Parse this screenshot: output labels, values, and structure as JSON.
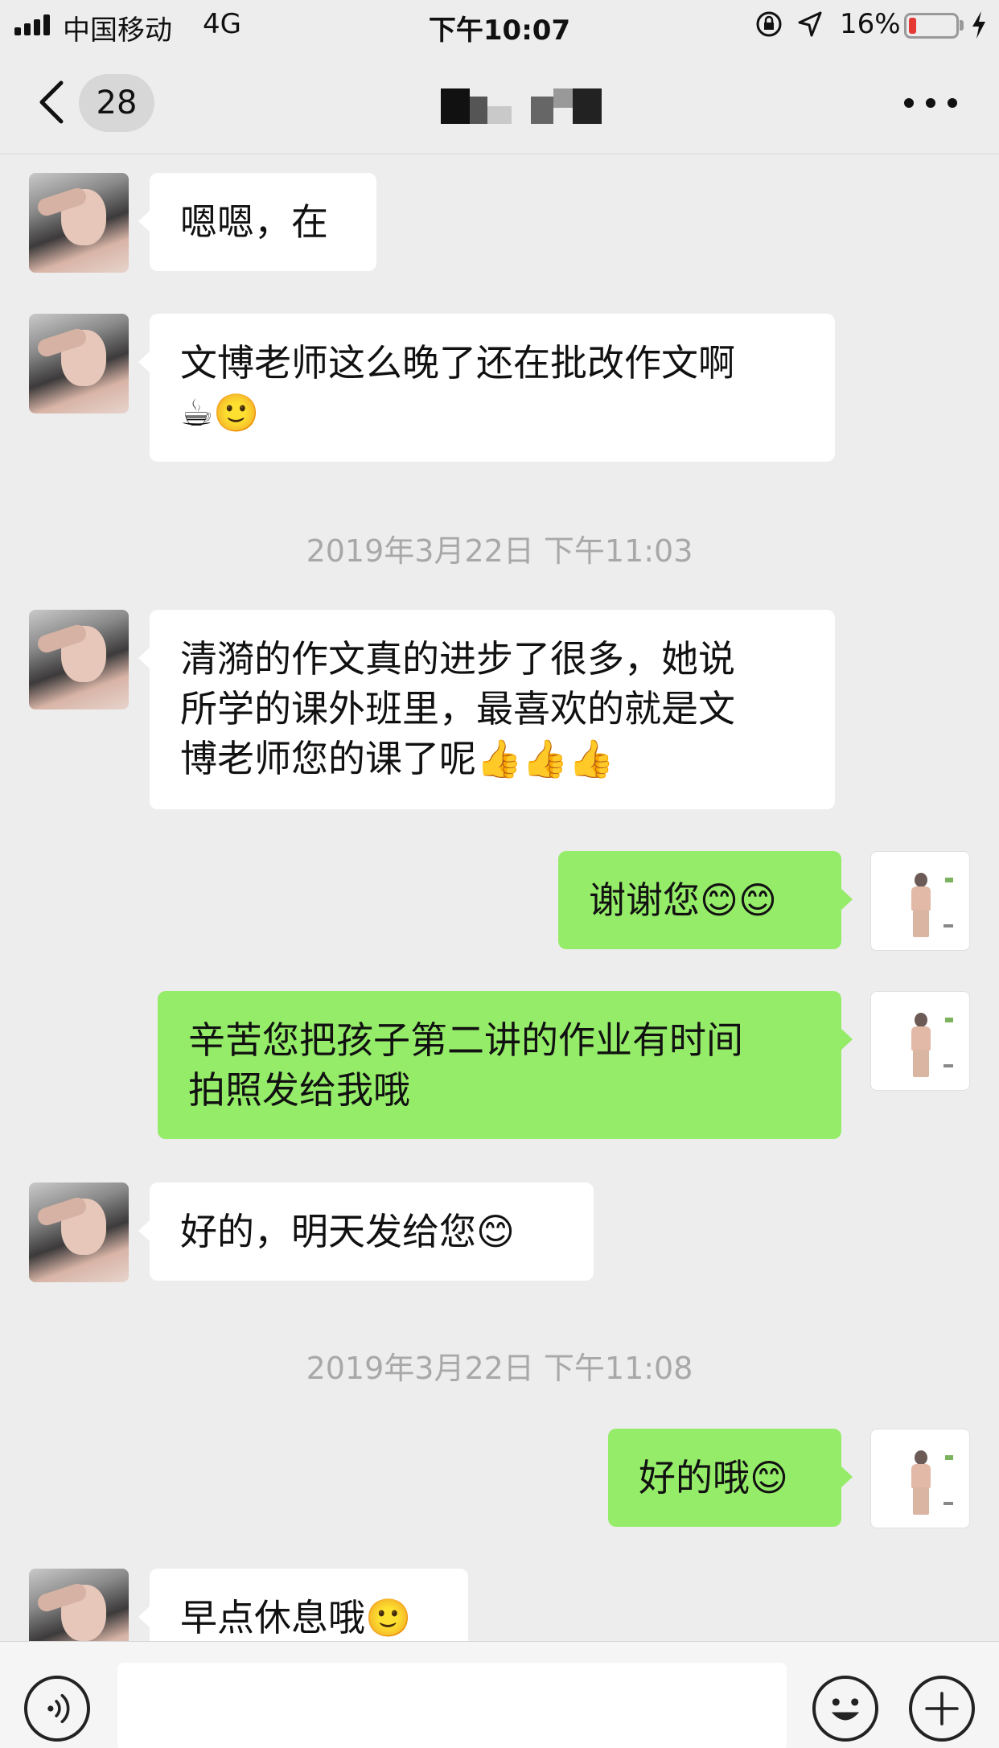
{
  "status_bar": {
    "carrier": "中国移动",
    "network": "4G",
    "time": "下午10:07",
    "battery_percent": "16%",
    "battery_level": 0.16,
    "battery_color": "#e53935"
  },
  "nav": {
    "unread_count": "28",
    "back_icon": "chevron-left-icon",
    "more_icon": "more-dots-icon"
  },
  "messages": [
    {
      "side": "in",
      "text": "嗯嗯，在"
    },
    {
      "side": "in",
      "text": "文博老师这么晚了还在批改作文啊\n☕🙂"
    },
    {
      "side": "time",
      "text": "2019年3月22日 下午11:03"
    },
    {
      "side": "in",
      "text": "清漪的作文真的进步了很多，她说\n所学的课外班里，最喜欢的就是文\n博老师您的课了呢👍👍👍"
    },
    {
      "side": "out",
      "text": "谢谢您😊😊"
    },
    {
      "side": "out",
      "text": "辛苦您把孩子第二讲的作业有时间\n拍照发给我哦"
    },
    {
      "side": "in",
      "text": "好的，明天发给您😊"
    },
    {
      "side": "time",
      "text": "2019年3月22日 下午11:08"
    },
    {
      "side": "out",
      "text": "好的哦😊"
    },
    {
      "side": "in",
      "text": "早点休息哦🙂"
    }
  ],
  "colors": {
    "background": "#ededed",
    "bubble_in": "#ffffff",
    "bubble_out": "#95ec69"
  },
  "input_bar": {
    "voice_icon": "voice-icon",
    "emoji_icon": "emoji-icon",
    "plus_icon": "plus-icon"
  }
}
